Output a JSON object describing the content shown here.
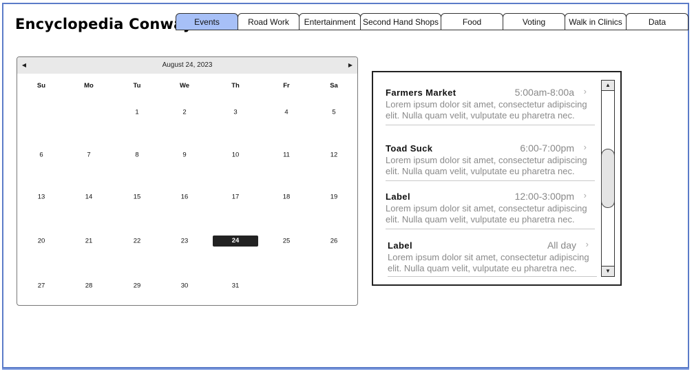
{
  "app": {
    "title": "Encyclopedia Conway"
  },
  "tabs": [
    {
      "label": "Events",
      "active": true
    },
    {
      "label": "Road Work",
      "active": false
    },
    {
      "label": "Entertainment",
      "active": false
    },
    {
      "label": "Second Hand Shops",
      "active": false
    },
    {
      "label": "Food",
      "active": false
    },
    {
      "label": "Voting",
      "active": false
    },
    {
      "label": "Walk in Clinics",
      "active": false
    },
    {
      "label": "Data",
      "active": false
    }
  ],
  "colors": {
    "active_tab": "#a7c0f7",
    "frame": "#5b7bc8",
    "selected_day": "#222222"
  },
  "calendar": {
    "header": "August 24, 2023",
    "prev_icon": "◀",
    "next_icon": "▶",
    "weekdays": [
      "Su",
      "Mo",
      "Tu",
      "We",
      "Th",
      "Fr",
      "Sa"
    ],
    "first_weekday_index": 2,
    "days_in_month": 31,
    "selected_day": 24
  },
  "events": {
    "items": [
      {
        "title": "Farmers Market",
        "time": "5:00am-8:00a",
        "description": "Lorem ipsum dolor sit amet, consectetur adipiscing elit. Nulla quam velit, vulputate eu pharetra nec."
      },
      {
        "title": "Toad Suck",
        "time": "6:00-7:00pm",
        "description": "Lorem ipsum dolor sit amet, consectetur adipiscing elit. Nulla quam velit, vulputate eu pharetra nec."
      },
      {
        "title": "Label",
        "time": "12:00-3:00pm",
        "description": "Lorem ipsum dolor sit amet, consectetur adipiscing elit. Nulla quam velit, vulputate eu pharetra nec."
      },
      {
        "title": "Label",
        "time": "All day",
        "description": "Lorem ipsum dolor sit amet, consectetur adipiscing elit. Nulla quam velit, vulputate eu pharetra nec."
      }
    ],
    "chevron": "›",
    "scroll_up_icon": "▲",
    "scroll_down_icon": "▼"
  }
}
